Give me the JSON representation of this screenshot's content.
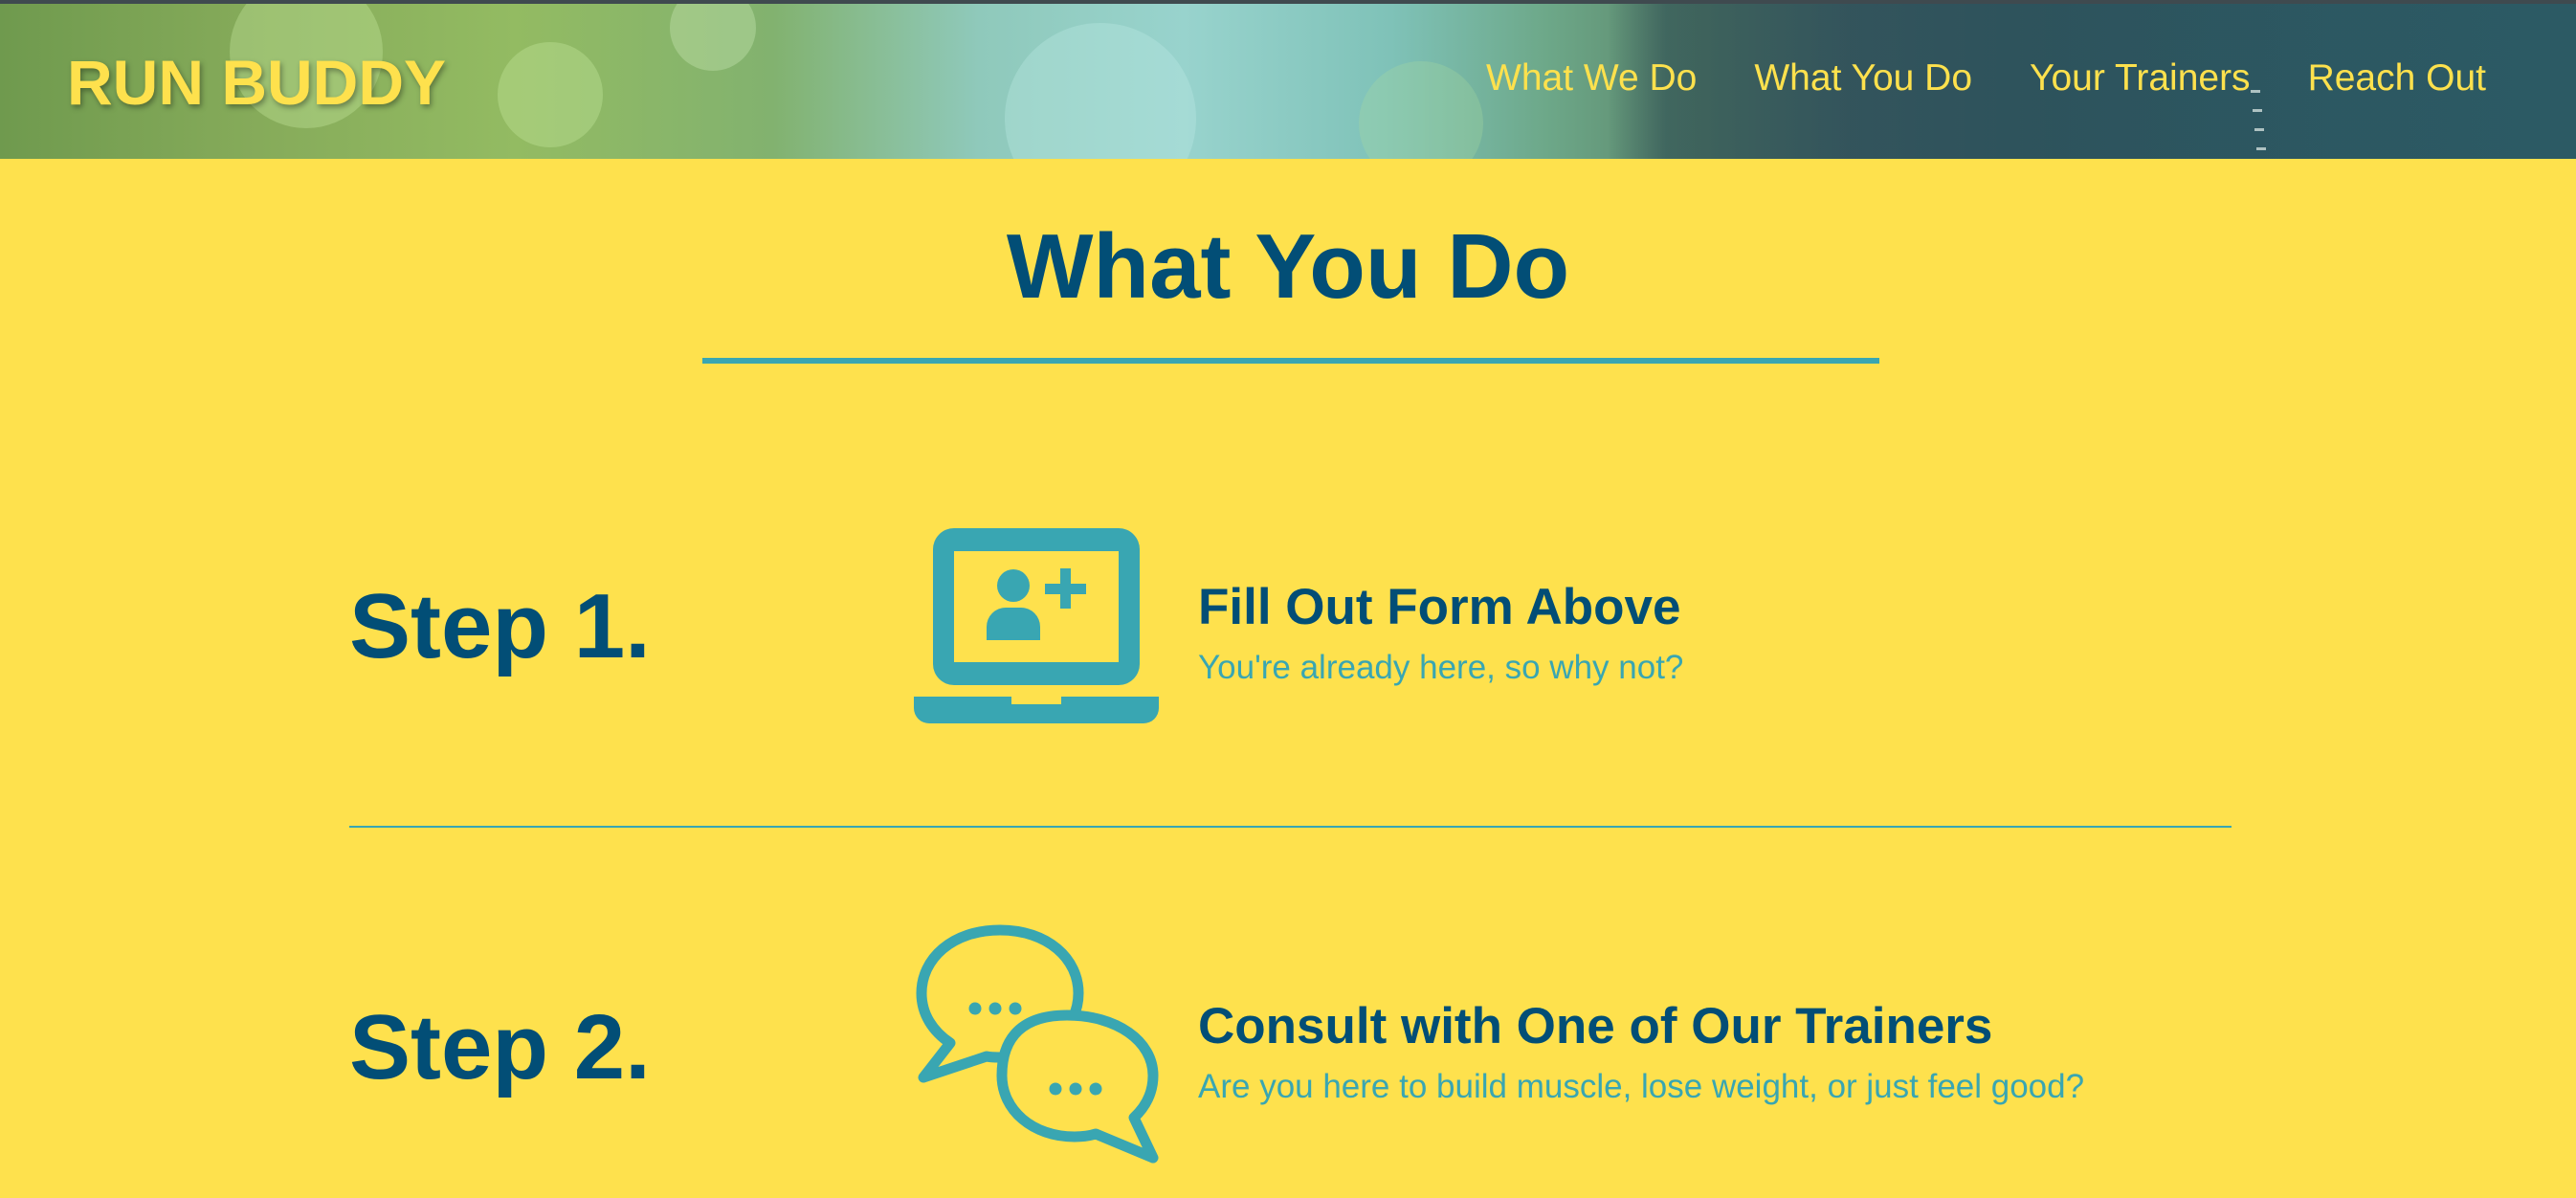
{
  "header": {
    "logo": "RUN BUDDY",
    "nav": [
      {
        "label": "What We Do"
      },
      {
        "label": "What You Do"
      },
      {
        "label": "Your Trainers"
      },
      {
        "label": "Reach Out"
      }
    ]
  },
  "section": {
    "title": "What You Do",
    "steps": [
      {
        "label": "Step 1.",
        "icon": "laptop-add-user-icon",
        "heading": "Fill Out Form Above",
        "text": "You're already here, so why not?"
      },
      {
        "label": "Step 2.",
        "icon": "chat-bubbles-icon",
        "heading": "Consult with One of Our Trainers",
        "text": "Are you here to build muscle, lose weight, or just feel good?"
      }
    ]
  },
  "colors": {
    "background": "#fee14d",
    "primary": "#024e76",
    "accent": "#39a6b2"
  }
}
